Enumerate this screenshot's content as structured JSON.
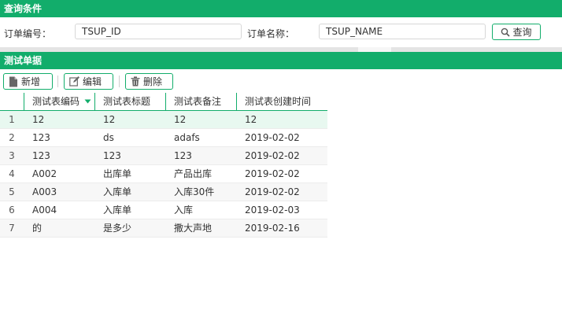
{
  "query_panel": {
    "title": "查询条件",
    "order_id_label": "订单编号：",
    "order_id_value": "TSUP_ID",
    "order_name_label": "订单名称：",
    "order_name_value": "TSUP_NAME",
    "search_button": "查询",
    "search_icon": "search-icon"
  },
  "list_panel": {
    "title": "测试单据"
  },
  "toolbar": {
    "add_label": "新增",
    "add_icon": "file-icon",
    "edit_label": "编辑",
    "edit_icon": "edit-icon",
    "delete_label": "删除",
    "delete_icon": "trash-icon"
  },
  "grid": {
    "columns": [
      "测试表编码",
      "测试表标题",
      "测试表备注",
      "测试表创建时间"
    ],
    "sorted_column_indicator": "sort-down-icon",
    "rows": [
      {
        "num": "1",
        "code": "12",
        "title": "12",
        "remark": "12",
        "created": "12"
      },
      {
        "num": "2",
        "code": "123",
        "title": "ds",
        "remark": "adafs",
        "created": "2019-02-02"
      },
      {
        "num": "3",
        "code": "123",
        "title": "123",
        "remark": "123",
        "created": "2019-02-02"
      },
      {
        "num": "4",
        "code": "A002",
        "title": "出库单",
        "remark": "产品出库",
        "created": "2019-02-02"
      },
      {
        "num": "5",
        "code": "A003",
        "title": "入库单",
        "remark": "入库30件",
        "created": "2019-02-02"
      },
      {
        "num": "6",
        "code": "A004",
        "title": "入库单",
        "remark": "入库",
        "created": "2019-02-03"
      },
      {
        "num": "7",
        "code": "的",
        "title": "是多少",
        "remark": "撒大声地",
        "created": "2019-02-16"
      }
    ]
  },
  "colors": {
    "accent": "#12ad6b",
    "selected_row": "#e8f8f0"
  }
}
